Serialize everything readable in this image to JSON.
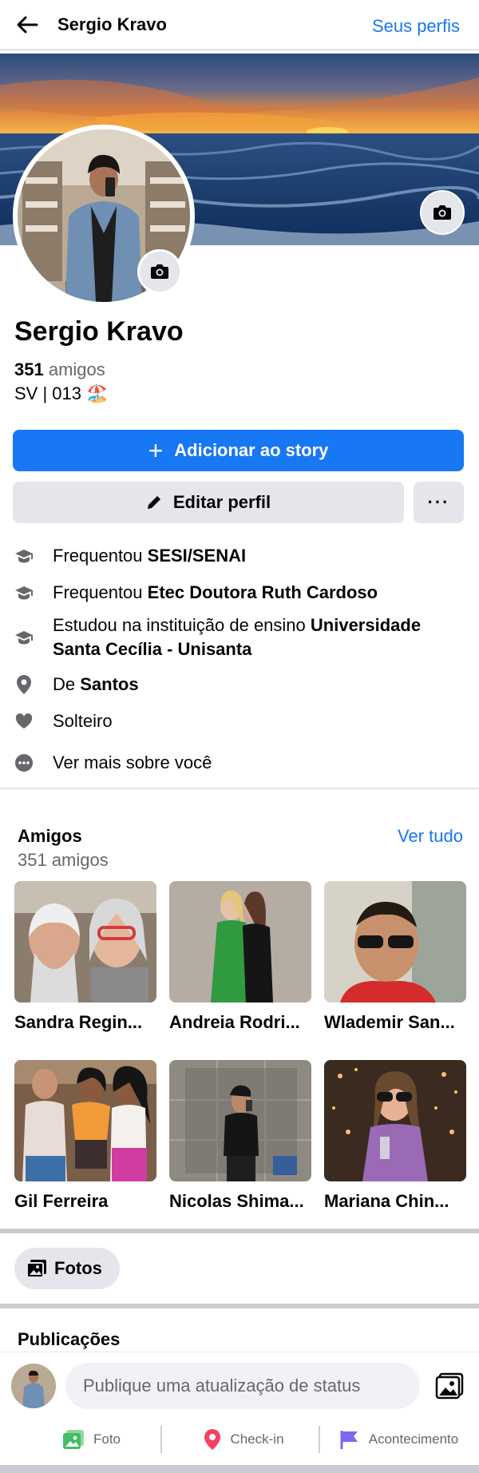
{
  "header": {
    "title": "Sergio Kravo",
    "link": "Seus perfis"
  },
  "profile": {
    "name": "Sergio Kravo",
    "friends_count": "351",
    "friends_word": "amigos",
    "bio": "SV | 013 🏖️"
  },
  "actions": {
    "add_story": "Adicionar ao story",
    "edit_profile": "Editar perfil",
    "more": "···"
  },
  "intro": [
    {
      "prefix": "Frequentou ",
      "bold": "SESI/SENAI",
      "icon": "graduation-cap-icon"
    },
    {
      "prefix": "Frequentou ",
      "bold": "Etec Doutora Ruth Cardoso",
      "icon": "graduation-cap-icon"
    },
    {
      "prefix": "Estudou na instituição de ensino ",
      "bold": "Universidade Santa Cecília - Unisanta",
      "icon": "graduation-cap-icon"
    },
    {
      "prefix": "De ",
      "bold": "Santos",
      "icon": "location-pin-icon"
    },
    {
      "prefix": "Solteiro",
      "bold": "",
      "icon": "heart-icon"
    },
    {
      "prefix": "Ver mais sobre você",
      "bold": "",
      "icon": "more-dots-icon"
    }
  ],
  "friends_section": {
    "title": "Amigos",
    "see_all": "Ver tudo",
    "count_text": "351 amigos",
    "friends": [
      {
        "name": "Sandra Regin..."
      },
      {
        "name": "Andreia Rodri..."
      },
      {
        "name": "Wlademir San..."
      },
      {
        "name": "Gil Ferreira"
      },
      {
        "name": "Nicolas Shima..."
      },
      {
        "name": "Mariana Chin..."
      }
    ]
  },
  "photos_chip": "Fotos",
  "posts": {
    "title": "Publicações",
    "composer_placeholder": "Publique uma atualização de status",
    "actions": [
      {
        "label": "Foto",
        "icon": "photo-icon",
        "color": "#45bd62"
      },
      {
        "label": "Check-in",
        "icon": "location-pin-icon",
        "color": "#f3425f"
      },
      {
        "label": "Acontecimento",
        "icon": "flag-icon",
        "color": "#7b68ee"
      }
    ]
  },
  "colors": {
    "accent": "#1877f2",
    "secondary_bg": "#e4e6eb",
    "muted_text": "#65676b"
  }
}
